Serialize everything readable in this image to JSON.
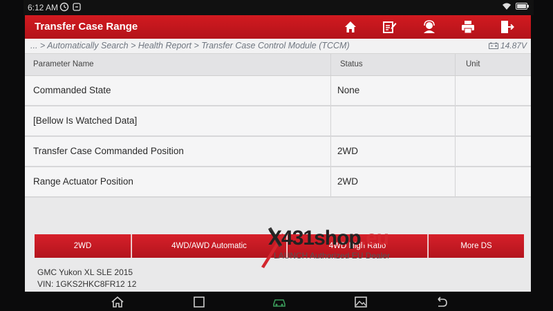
{
  "statusbar": {
    "time": "6:12 AM",
    "battery_level": 0.9
  },
  "header": {
    "title": "Transfer Case Range",
    "buttons": [
      "home-icon",
      "edit-icon",
      "support-icon",
      "print-icon",
      "exit-icon"
    ]
  },
  "breadcrumb": {
    "text": "... > Automatically Search > Health Report > Transfer Case Control Module (TCCM)",
    "voltage": "14.87V"
  },
  "table": {
    "columns": [
      "Parameter Name",
      "Status",
      "Unit"
    ],
    "rows": [
      {
        "name": "Commanded State",
        "status": "None",
        "unit": ""
      },
      {
        "name": "[Bellow Is Watched Data]",
        "status": "",
        "unit": ""
      },
      {
        "name": "Transfer Case Commanded Position",
        "status": "2WD",
        "unit": ""
      },
      {
        "name": "Range Actuator Position",
        "status": "2WD",
        "unit": ""
      }
    ]
  },
  "action_buttons": [
    "2WD",
    "4WD/AWD Automatic",
    "4WD High Ratio",
    "More DS"
  ],
  "vehicle": {
    "model": "GMC Yukon XL SLE 2015",
    "vin": "VIN: 1GKS2HKC8FR12 12"
  },
  "watermark": {
    "brand_main": "X431shop",
    "brand_suffix": ".eu",
    "tagline": "LAUNCH Authorized EU Dealer"
  },
  "colors": {
    "header_red": "#c8161d",
    "button_red": "#c81a22",
    "background": "#e9e9ea"
  },
  "navbar": [
    "home-icon",
    "recents-icon",
    "car-icon",
    "gallery-icon",
    "back-icon"
  ]
}
